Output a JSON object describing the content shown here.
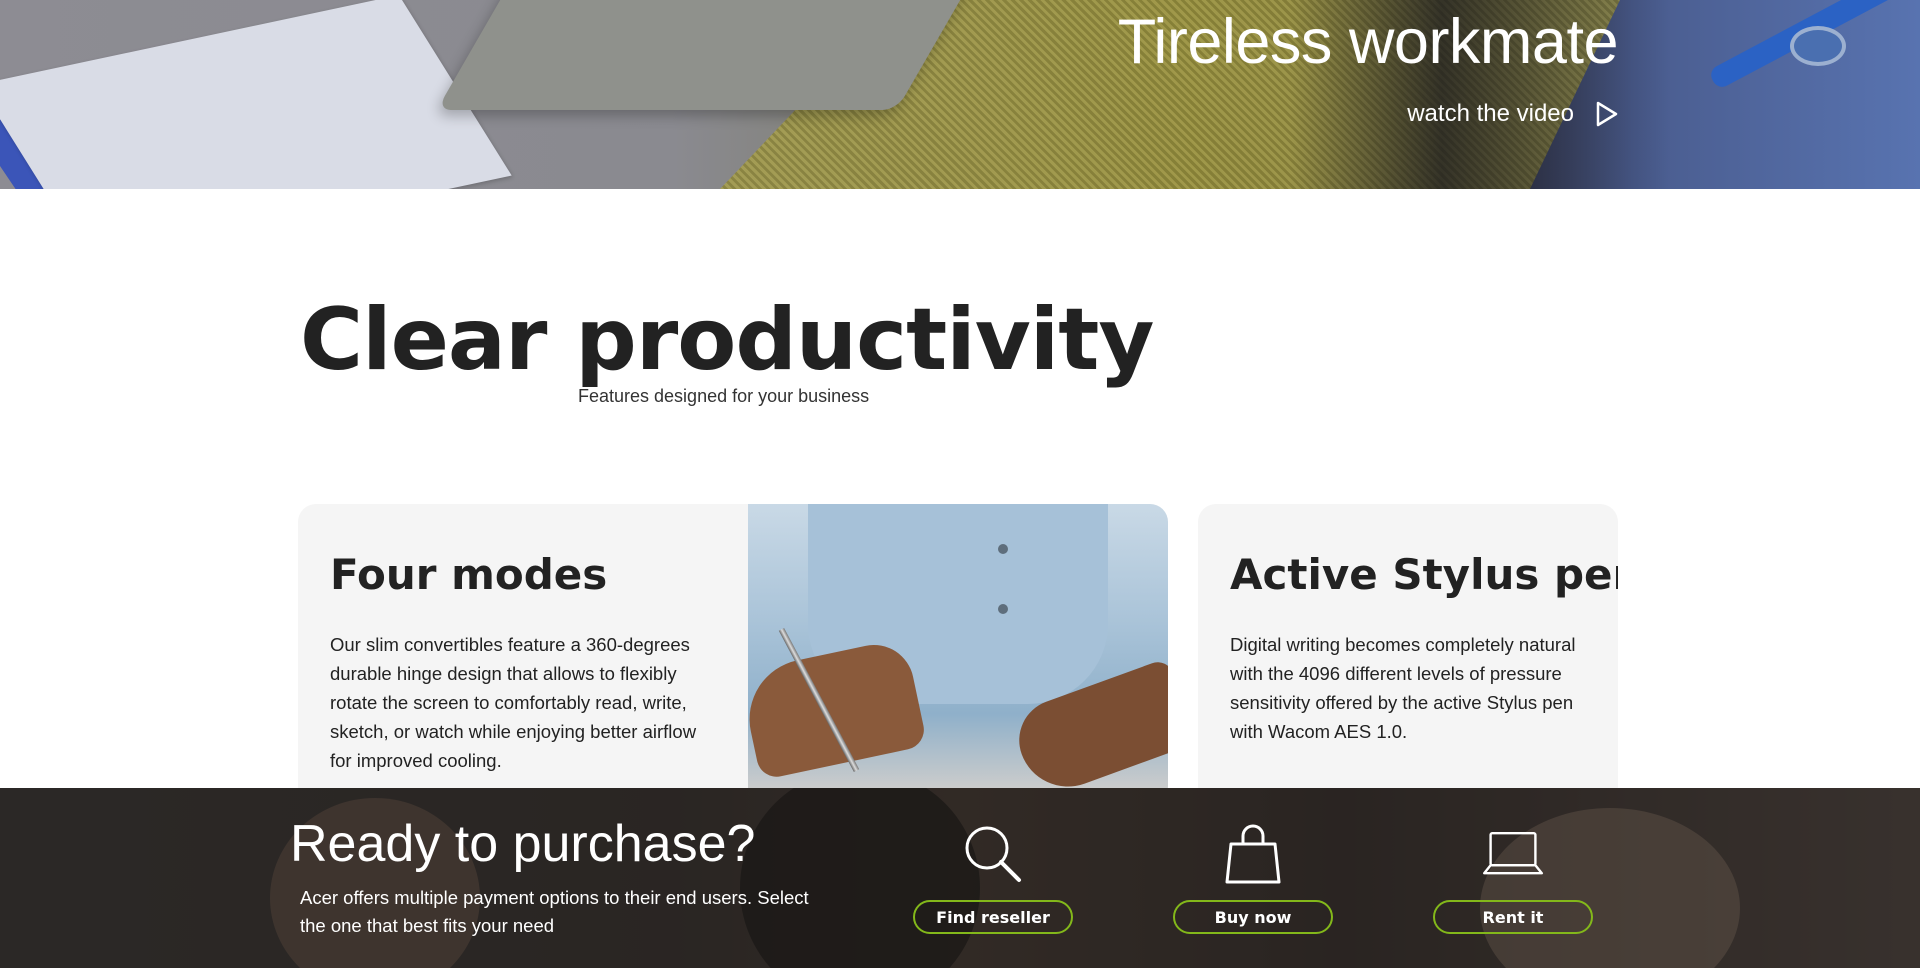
{
  "hero": {
    "title": "Tireless workmate",
    "cta_label": "watch the video",
    "cta_icon": "play-icon"
  },
  "intro": {
    "title": "Clear productivity",
    "subtitle": "Features designed for your business"
  },
  "cards": [
    {
      "title": "Four modes",
      "text": "Our slim convertibles feature a 360-degrees durable hinge design that allows to flexibly rotate the screen to comfortably read, write, sketch, or watch while enjoying better airflow for improved cooling."
    },
    {
      "title": "Active Stylus pen",
      "text": "Digital writing becomes completely natural with the 4096 different levels of pressure sensitivity offered by the active Stylus pen with Wacom AES 1.0."
    }
  ],
  "purchase": {
    "title": "Ready to purchase?",
    "description": "Acer offers multiple payment options to their end users. Select the one that best fits your need",
    "options": [
      {
        "label": "Find reseller",
        "icon": "magnifier-icon"
      },
      {
        "label": "Buy now",
        "icon": "shopping-bag-icon"
      },
      {
        "label": "Rent it",
        "icon": "laptop-icon"
      }
    ],
    "accent_color": "#83b81a"
  }
}
